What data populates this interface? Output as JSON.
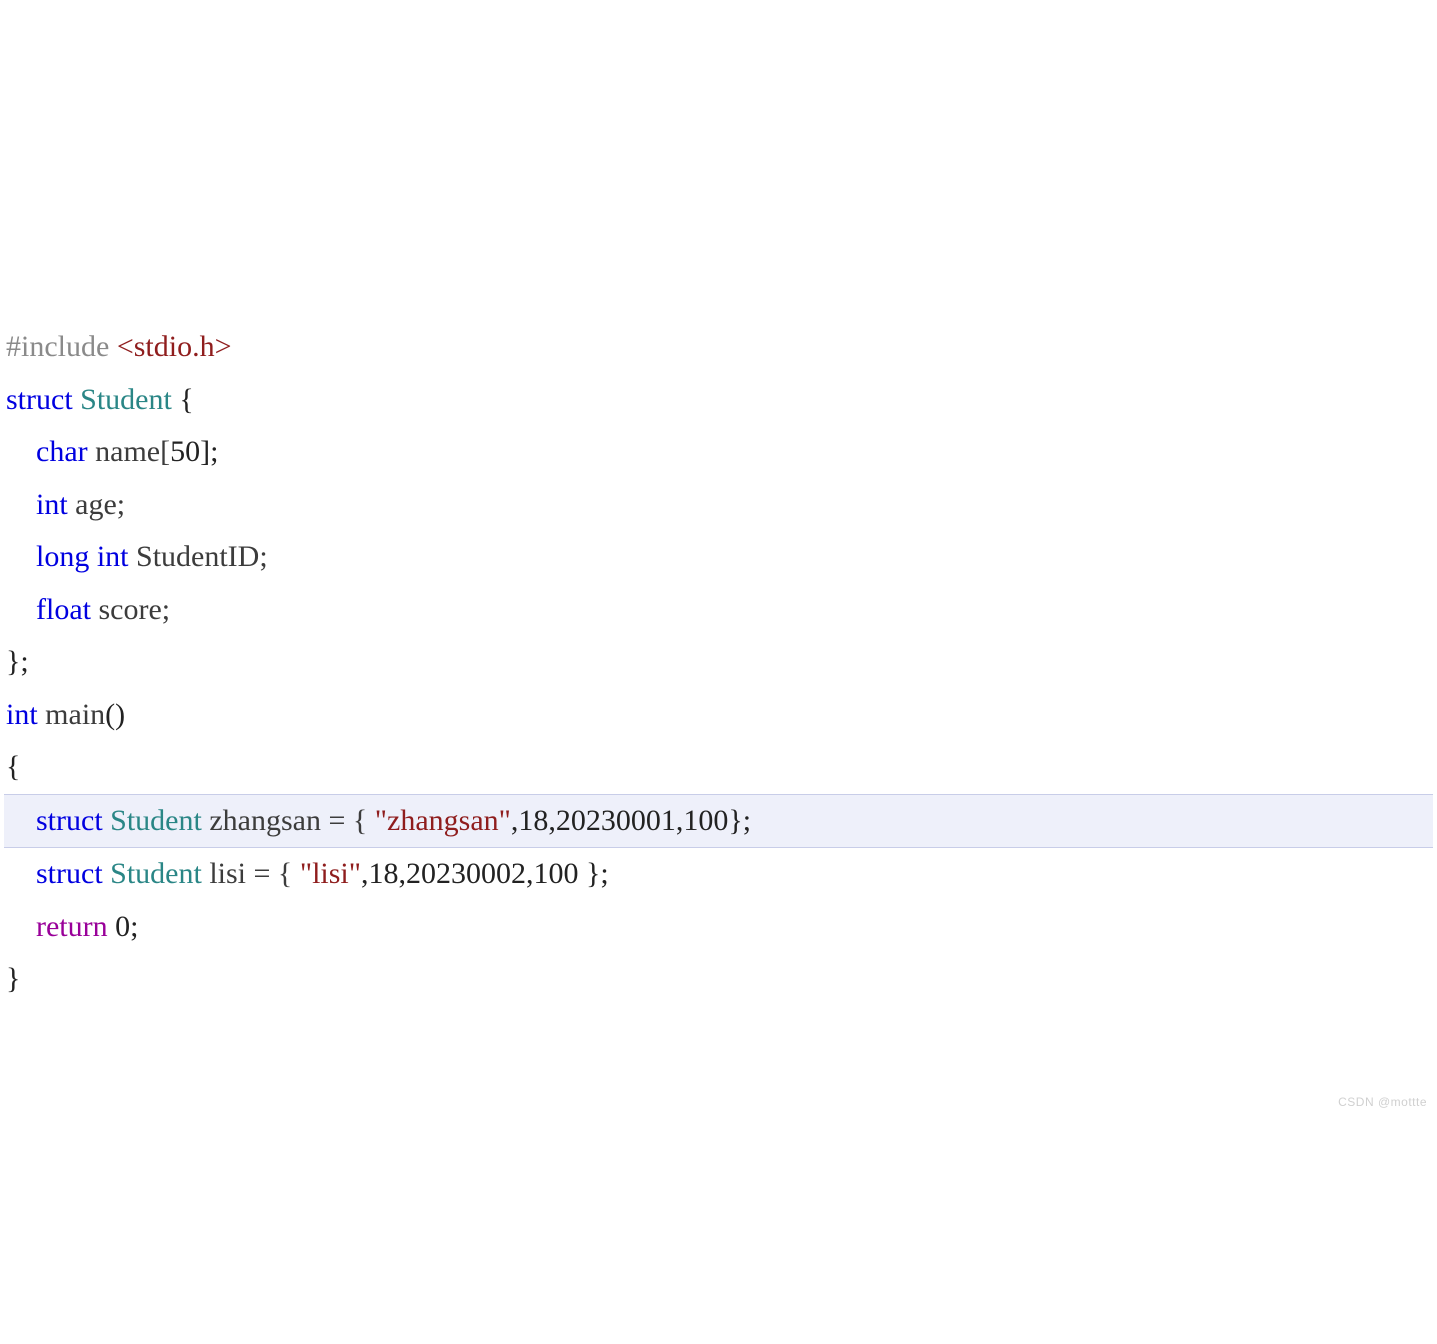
{
  "code": {
    "lines": [
      {
        "highlight": false,
        "tokens": [
          {
            "t": "#include ",
            "cls": "tok-preproc"
          },
          {
            "t": "<stdio.h>",
            "cls": "tok-include"
          }
        ]
      },
      {
        "highlight": false,
        "tokens": [
          {
            "t": "struct",
            "cls": "tok-keyword"
          },
          {
            "t": " ",
            "cls": ""
          },
          {
            "t": "Student",
            "cls": "tok-type"
          },
          {
            "t": " {",
            "cls": "tok-punct"
          }
        ]
      },
      {
        "highlight": false,
        "indent": true,
        "tokens": [
          {
            "t": "    ",
            "cls": ""
          },
          {
            "t": "char",
            "cls": "tok-keyword"
          },
          {
            "t": " name[",
            "cls": "tok-ident"
          },
          {
            "t": "50",
            "cls": "tok-num"
          },
          {
            "t": "];",
            "cls": "tok-punct"
          }
        ]
      },
      {
        "highlight": false,
        "indent": true,
        "tokens": [
          {
            "t": "    ",
            "cls": ""
          },
          {
            "t": "int",
            "cls": "tok-keyword"
          },
          {
            "t": " age;",
            "cls": "tok-ident"
          }
        ]
      },
      {
        "highlight": false,
        "indent": true,
        "tokens": [
          {
            "t": "    ",
            "cls": ""
          },
          {
            "t": "long",
            "cls": "tok-keyword"
          },
          {
            "t": " ",
            "cls": ""
          },
          {
            "t": "int",
            "cls": "tok-keyword"
          },
          {
            "t": " StudentID;",
            "cls": "tok-ident"
          }
        ]
      },
      {
        "highlight": false,
        "indent": true,
        "tokens": [
          {
            "t": "    ",
            "cls": ""
          },
          {
            "t": "float",
            "cls": "tok-keyword"
          },
          {
            "t": " score;",
            "cls": "tok-ident"
          }
        ]
      },
      {
        "highlight": false,
        "tokens": [
          {
            "t": "};",
            "cls": "tok-punct"
          }
        ]
      },
      {
        "highlight": false,
        "tokens": [
          {
            "t": "int",
            "cls": "tok-keyword"
          },
          {
            "t": " ",
            "cls": ""
          },
          {
            "t": "main",
            "cls": "tok-ident"
          },
          {
            "t": "()",
            "cls": "tok-punct"
          }
        ]
      },
      {
        "highlight": false,
        "tokens": [
          {
            "t": "{",
            "cls": "tok-punct"
          }
        ]
      },
      {
        "highlight": true,
        "indent": true,
        "tokens": [
          {
            "t": "    ",
            "cls": ""
          },
          {
            "t": "struct",
            "cls": "tok-keyword"
          },
          {
            "t": " ",
            "cls": ""
          },
          {
            "t": "Student",
            "cls": "tok-type"
          },
          {
            "t": " zhangsan = { ",
            "cls": "tok-ident"
          },
          {
            "t": "\"zhangsan\"",
            "cls": "tok-string"
          },
          {
            "t": ",",
            "cls": "tok-punct"
          },
          {
            "t": "18",
            "cls": "tok-num"
          },
          {
            "t": ",",
            "cls": "tok-punct"
          },
          {
            "t": "20230001",
            "cls": "tok-num"
          },
          {
            "t": ",",
            "cls": "tok-punct"
          },
          {
            "t": "100",
            "cls": "tok-num"
          },
          {
            "t": "};",
            "cls": "tok-punct"
          }
        ]
      },
      {
        "highlight": false,
        "indent": true,
        "tokens": [
          {
            "t": "    ",
            "cls": ""
          },
          {
            "t": "struct",
            "cls": "tok-keyword"
          },
          {
            "t": " ",
            "cls": ""
          },
          {
            "t": "Student",
            "cls": "tok-type"
          },
          {
            "t": " lisi = { ",
            "cls": "tok-ident"
          },
          {
            "t": "\"lisi\"",
            "cls": "tok-string"
          },
          {
            "t": ",",
            "cls": "tok-punct"
          },
          {
            "t": "18",
            "cls": "tok-num"
          },
          {
            "t": ",",
            "cls": "tok-punct"
          },
          {
            "t": "20230002",
            "cls": "tok-num"
          },
          {
            "t": ",",
            "cls": "tok-punct"
          },
          {
            "t": "100",
            "cls": "tok-num"
          },
          {
            "t": " };",
            "cls": "tok-punct"
          }
        ]
      },
      {
        "highlight": false,
        "indent": true,
        "tokens": [
          {
            "t": "    ",
            "cls": ""
          },
          {
            "t": "return",
            "cls": "tok-return"
          },
          {
            "t": " ",
            "cls": ""
          },
          {
            "t": "0",
            "cls": "tok-num"
          },
          {
            "t": ";",
            "cls": "tok-punct"
          }
        ]
      },
      {
        "highlight": false,
        "tokens": [
          {
            "t": "}",
            "cls": "tok-punct"
          }
        ]
      }
    ]
  },
  "watermark": "CSDN @mottte"
}
